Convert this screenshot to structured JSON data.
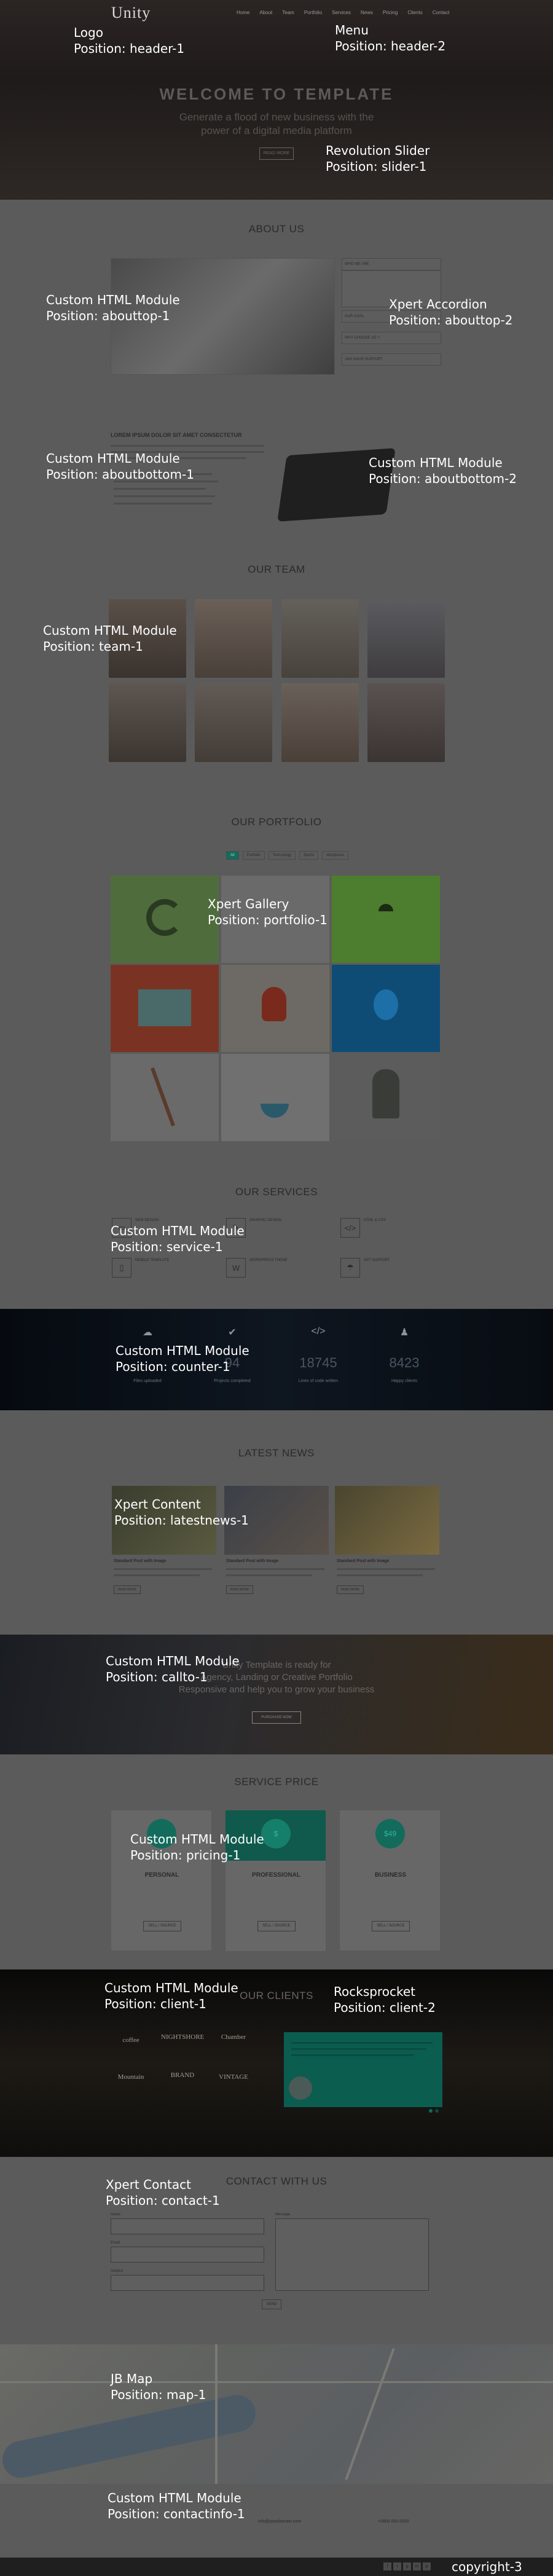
{
  "header": {
    "logo_text": "Unity",
    "menu_items": [
      "Home",
      "About",
      "Team",
      "Portfolio",
      "Services",
      "News",
      "Pricing",
      "Clients",
      "Contact"
    ],
    "logo_label": "Logo",
    "logo_position": "Position: header-1",
    "menu_label": "Menu",
    "menu_position": "Position: header-2"
  },
  "slider": {
    "title": "WELCOME TO TEMPLATE",
    "subtitle_line1": "Generate a flood of new business with the",
    "subtitle_line2": "power of a digital media platform",
    "button": "READ MORE",
    "module_label": "Revolution Slider",
    "module_position": "Position: slider-1"
  },
  "about": {
    "title": "ABOUT US",
    "accordion_items": [
      "WHO WE ARE",
      "OUR GOAL",
      "WHY CHOOSE US ?",
      "24/6 HOUR SUPPORT"
    ],
    "aboutbottom_heading": "LOREM IPSUM DOLOR SIT AMET CONSECTETUR",
    "abouttop1_label": "Custom HTML Module",
    "abouttop1_position": "Position: abouttop-1",
    "abouttop2_label": "Xpert Accordion",
    "abouttop2_position": "Position: abouttop-2",
    "aboutbottom1_label": "Custom HTML Module",
    "aboutbottom1_position": "Position: aboutbottom-1",
    "aboutbottom2_label": "Custom HTML Module",
    "aboutbottom2_position": "Position: aboutbottom-2"
  },
  "team": {
    "title": "OUR TEAM",
    "module_label": "Custom HTML Module",
    "module_position": "Position: team-1"
  },
  "portfolio": {
    "title": "OUR PORTFOLIO",
    "filters": [
      "All",
      "Portfolio",
      "Technology",
      "Sports",
      "Wordpress"
    ],
    "module_label": "Xpert Gallery",
    "module_position": "Position: portfolio-1"
  },
  "services": {
    "title": "OUR SERVICES",
    "items": [
      {
        "name": "WEB DESIGN",
        "icon": "monitor-icon"
      },
      {
        "name": "GRAPHIC DESIGN",
        "icon": "pencil-icon"
      },
      {
        "name": "HTML & CSS",
        "icon": "code-icon"
      },
      {
        "name": "MOBILE TEMPLATE",
        "icon": "mobile-icon"
      },
      {
        "name": "WORDPRESS THEME",
        "icon": "wordpress-icon"
      },
      {
        "name": "24/7 SUPPORT",
        "icon": "umbrella-icon"
      }
    ],
    "module_label": "Custom HTML Module",
    "module_position": "Position: service-1"
  },
  "counter": {
    "items": [
      {
        "value": "",
        "label": "Files uploaded",
        "icon": "cloud-icon"
      },
      {
        "value": "94",
        "label": "Projects completed",
        "icon": "check-icon"
      },
      {
        "value": "18745",
        "label": "Lines of code written",
        "icon": "code-icon"
      },
      {
        "value": "8423",
        "label": "Happy clients",
        "icon": "person-icon"
      }
    ],
    "module_label": "Custom HTML Module",
    "module_position": "Position: counter-1"
  },
  "news": {
    "title": "LATEST NEWS",
    "items": [
      {
        "title": "Standard Post with Image",
        "button": "READ MORE"
      },
      {
        "title": "Standard Post with Image",
        "button": "READ MORE"
      },
      {
        "title": "Standard Post with Image",
        "button": "READ MORE"
      }
    ],
    "module_label": "Xpert Content",
    "module_position": "Position: latestnews-1"
  },
  "callto": {
    "line1": "Unity Template is ready for",
    "line2": "Agency, Landing or Creative Portfolio",
    "line3": "Responsive and help you to grow your business",
    "button": "PURCHASE NOW",
    "module_label": "Custom HTML Module",
    "module_position": "Position: callto-1"
  },
  "pricing": {
    "title": "SERVICE PRICE",
    "plans": [
      {
        "name": "PERSONAL",
        "price": "",
        "button": "SELL / SOURCE"
      },
      {
        "name": "PROFESSIONAL",
        "price": "$",
        "button": "SELL / SOURCE"
      },
      {
        "name": "BUSINESS",
        "price": "$49",
        "button": "SELL / SOURCE"
      }
    ],
    "module_label": "Custom HTML Module",
    "module_position": "Position: pricing-1"
  },
  "clients": {
    "title": "OUR CLIENTS",
    "logos": [
      "coffee",
      "NIGHTSHORE",
      "Chamber",
      "Mountain",
      "BRAND",
      "VINTAGE"
    ],
    "client1_label": "Custom HTML Module",
    "client1_position": "Position: client-1",
    "client2_label": "Rocksprocket",
    "client2_position": "Position: client-2"
  },
  "contact": {
    "title": "CONTACT WITH US",
    "fields": [
      "Name",
      "Email",
      "Subject"
    ],
    "message_label": "Message",
    "send_button": "SEND",
    "module_label": "Xpert Contact",
    "module_position": "Position: contact-1"
  },
  "map": {
    "module_label": "JB Map",
    "module_position": "Position: map-1"
  },
  "contactinfo": {
    "email": "info@yourdomain.com",
    "phone": "+0800 000 0000",
    "module_label": "Custom HTML Module",
    "module_position": "Position: contactinfo-1"
  },
  "copyright": {
    "label": "copyright-3",
    "social_icons": [
      "facebook-icon",
      "twitter-icon",
      "google-plus-icon",
      "linkedin-icon",
      "pinterest-icon"
    ]
  }
}
